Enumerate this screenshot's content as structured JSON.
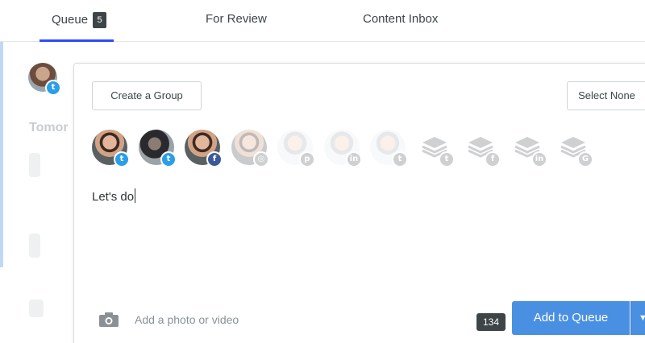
{
  "tabs": {
    "queue": {
      "label": "Queue",
      "count": "5"
    },
    "review": {
      "label": "For Review"
    },
    "inbox": {
      "label": "Content Inbox"
    }
  },
  "background": {
    "day_label": "Tomor"
  },
  "composer": {
    "create_group_label": "Create a Group",
    "select_none_label": "Select None",
    "profiles": [
      {
        "network": "twitter",
        "selected": true
      },
      {
        "network": "twitter",
        "selected": true
      },
      {
        "network": "facebook",
        "selected": true
      },
      {
        "network": "instagram",
        "selected": false
      },
      {
        "network": "pinterest",
        "selected": false
      },
      {
        "network": "linkedin",
        "selected": false
      },
      {
        "network": "twitter",
        "selected": false
      },
      {
        "network": "twitter-group",
        "selected": false
      },
      {
        "network": "facebook-group",
        "selected": false
      },
      {
        "network": "linkedin-group",
        "selected": false
      },
      {
        "network": "googleplus-group",
        "selected": false
      }
    ],
    "post_text": "Let's do",
    "attach_label": "Add a photo or video",
    "char_count": "134",
    "submit_label": "Add to Queue",
    "dropdown_icon": "caret-down-icon"
  },
  "colors": {
    "accent": "#4a90e2",
    "tab_underline": "#2c4bff",
    "twitter": "#2b9ee8",
    "facebook": "#3b5998"
  }
}
